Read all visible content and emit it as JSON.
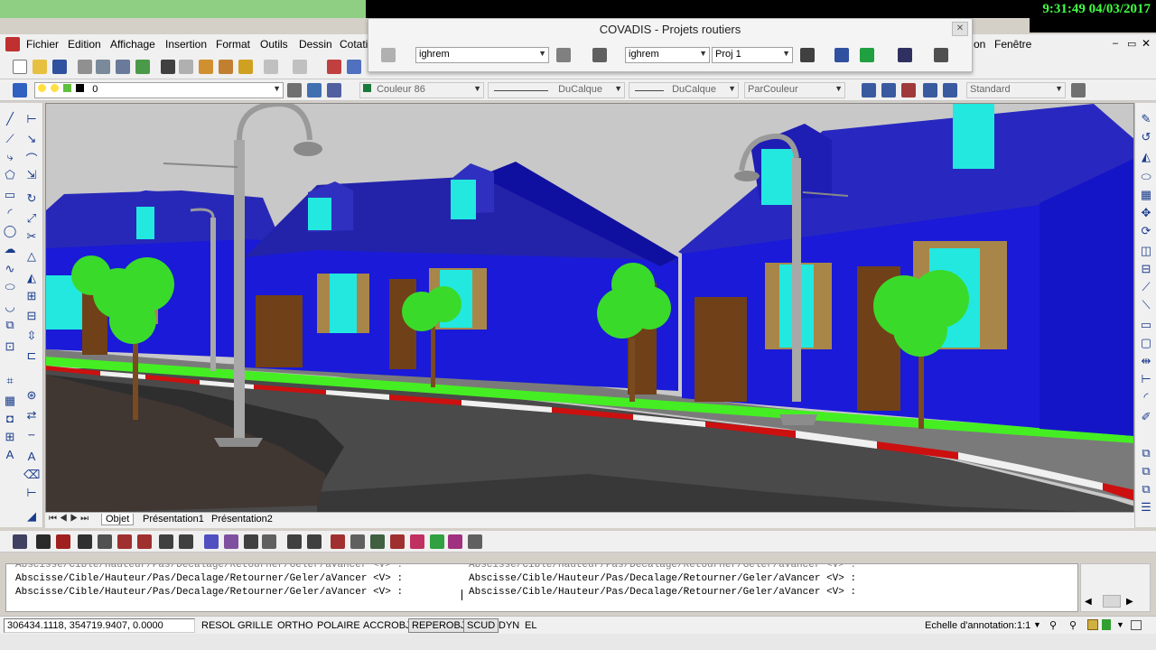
{
  "clock": {
    "time": "9:31:49",
    "date": "04/03/2017"
  },
  "menu": {
    "items": [
      "Fichier",
      "Edition",
      "Affichage",
      "Insertion",
      "Format",
      "Outils",
      "Dessin",
      "Cotati"
    ],
    "right_items": [
      "on",
      "Fenêtre"
    ]
  },
  "covadis": {
    "title": "COVADIS - Projets routiers",
    "combo1": "ighrem",
    "combo2": "ighrem",
    "combo3": "Proj 1"
  },
  "layer_toolbar": {
    "layer": "0",
    "color": "Couleur 86",
    "linetype": "DuCalque",
    "lineweight": "DuCalque",
    "plotstyle": "ParCouleur",
    "style": "Standard"
  },
  "tabs": [
    "Objet",
    "Présentation1",
    "Présentation2"
  ],
  "command_lines": {
    "left": [
      "Abscisse/Cible/Hauteur/Pas/Decalage/Retourner/Geler/aVancer <V> :",
      "Abscisse/Cible/Hauteur/Pas/Decalage/Retourner/Geler/aVancer <V> :",
      "Abscisse/Cible/Hauteur/Pas/Decalage/Retourner/Geler/aVancer <V> :"
    ],
    "right": [
      "Abscisse/Cible/Hauteur/Pas/Decalage/Retourner/Geler/aVancer <V> :",
      "Abscisse/Cible/Hauteur/Pas/Decalage/Retourner/Geler/aVancer <V> :",
      "Abscisse/Cible/Hauteur/Pas/Decalage/Retourner/Geler/aVancer <V> :"
    ]
  },
  "status": {
    "coords": "306434.1118, 354719.9407, 0.0000",
    "modes": [
      "RESOL",
      "GRILLE",
      "ORTHO",
      "POLAIRE",
      "ACCROBJ",
      "REPEROBJ",
      "SCUD",
      "DYN",
      "EL"
    ],
    "active_modes": [
      "REPEROBJ",
      "SCUD"
    ],
    "annotation_label": "Echelle d'annotation:",
    "annotation_scale": "1:1"
  },
  "colors": {
    "house_blue": "#1a1ad8",
    "roof_blue": "#2020a0",
    "window_cyan": "#22e8e0",
    "door_brown": "#704018",
    "shutter_tan": "#a8864a",
    "grass_green": "#44ee22",
    "curb_red": "#cc1010",
    "road_gray": "#444444"
  }
}
